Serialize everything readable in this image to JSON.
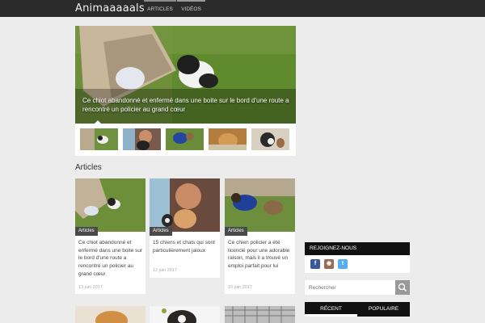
{
  "site": {
    "logo": "Animaaaaals",
    "nav": [
      {
        "label": "ARTICLES"
      },
      {
        "label": "VIDÉOS"
      }
    ]
  },
  "hero": {
    "caption": "Ce chiot abandonné et enfermé dans une boite sur le bord d'une route a rencontré un policier au grand cœur"
  },
  "main": {
    "section_title": "Articles"
  },
  "articles": [
    {
      "badge": "Articles",
      "title": "Ce chiot abandonné et enfermé dans une boite sur le bord d'une route a rencontré un policier au grand cœur",
      "date": "13 juin 2017"
    },
    {
      "badge": "Articles",
      "title": "15 chiens et chats qui sont particulièrement jaloux",
      "date": "12 juin 2017"
    },
    {
      "badge": "Articles",
      "title": "Ce chien policier a été licencié pour une adorable raison, mais il a trouvé un emploi parfait pour lui",
      "date": "10 juin 2017"
    }
  ],
  "sidebar": {
    "join_title": "REJOIGNEZ-NOUS",
    "social": [
      {
        "icon": "facebook-icon",
        "glyph": "f",
        "color": "#3b5998"
      },
      {
        "icon": "instagram-icon",
        "glyph": "◉",
        "color": "#9b6954"
      },
      {
        "icon": "twitter-icon",
        "glyph": "t",
        "color": "#55acee"
      }
    ],
    "search_placeholder": "Rechercher",
    "tabs": [
      {
        "label": "RÉCENT"
      },
      {
        "label": "POPULAIRE"
      }
    ]
  }
}
